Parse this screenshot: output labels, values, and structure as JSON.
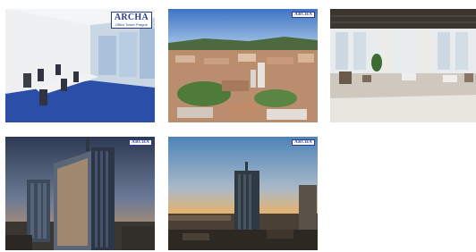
{
  "badge": {
    "logo_text": "ARCHA",
    "tagline": "Office Tower Prague"
  },
  "thumbnails": [
    {
      "subject": "office-meeting-room"
    },
    {
      "subject": "city-aerial-view"
    },
    {
      "subject": "open-plan-office"
    },
    {
      "subject": "tower-exterior-dusk"
    },
    {
      "subject": "tower-sunset-skyline"
    }
  ],
  "colors": {
    "badge_brand": "#2a3a8c",
    "carpet_blue": "#2b4fa8",
    "sky_dusk": "#2e3a54",
    "sky_sunset": "#f2b25e"
  }
}
